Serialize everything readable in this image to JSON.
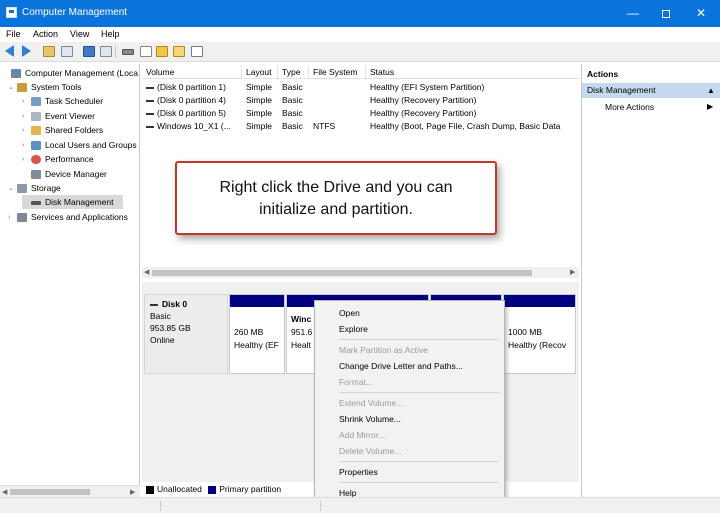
{
  "window": {
    "title": "Computer Management",
    "minimize_glyph": "—",
    "close_glyph": "✕"
  },
  "menu": [
    "File",
    "Action",
    "View",
    "Help"
  ],
  "toolbar": {
    "icons": [
      "back-icon",
      "forward-icon",
      "folder-icon",
      "view-icon",
      "properties-icon",
      "details-icon",
      "connect-icon",
      "document-icon",
      "folder-open-icon",
      "list-icon",
      "console-icon"
    ]
  },
  "tree": {
    "items": [
      {
        "label": "Computer Management (Loca",
        "level": 0,
        "expand": "",
        "icon": "computer-icon",
        "color": "#6b87a8"
      },
      {
        "label": "System Tools",
        "level": 1,
        "expand": "⌄",
        "icon": "tools-icon",
        "color": "#c99a3b"
      },
      {
        "label": "Task Scheduler",
        "level": 2,
        "expand": "›",
        "icon": "clock-icon",
        "color": "#7a9cc4"
      },
      {
        "label": "Event Viewer",
        "level": 2,
        "expand": "›",
        "icon": "event-icon",
        "color": "#a9b8c8"
      },
      {
        "label": "Shared Folders",
        "level": 2,
        "expand": "›",
        "icon": "folder-icon",
        "color": "#e0b64e"
      },
      {
        "label": "Local Users and Groups",
        "level": 2,
        "expand": "›",
        "icon": "users-icon",
        "color": "#5d8fcb"
      },
      {
        "label": "Performance",
        "level": 2,
        "expand": "›",
        "icon": "performance-icon",
        "color": "#d9534f"
      },
      {
        "label": "Device Manager",
        "level": 2,
        "expand": "",
        "icon": "device-icon",
        "color": "#7f8c99"
      },
      {
        "label": "Storage",
        "level": 1,
        "expand": "⌄",
        "icon": "storage-icon",
        "color": "#8a98a8"
      },
      {
        "label": "Disk Management",
        "level": 2,
        "expand": "",
        "icon": "disk-icon",
        "color": "#555555",
        "selected": true
      },
      {
        "label": "Services and Applications",
        "level": 1,
        "expand": "›",
        "icon": "services-icon",
        "color": "#7a8898"
      }
    ]
  },
  "table": {
    "columns": [
      "Volume",
      "Layout",
      "Type",
      "File System",
      "Status"
    ],
    "rows": [
      [
        "(Disk 0 partition 1)",
        "Simple",
        "Basic",
        "",
        "Healthy (EFI System Partition)"
      ],
      [
        "(Disk 0 partition 4)",
        "Simple",
        "Basic",
        "",
        "Healthy (Recovery Partition)"
      ],
      [
        "(Disk 0 partition 5)",
        "Simple",
        "Basic",
        "",
        "Healthy (Recovery Partition)"
      ],
      [
        "Windows 10_X1 (...",
        "Simple",
        "Basic",
        "NTFS",
        "Healthy (Boot, Page File, Crash Dump, Basic Data"
      ]
    ]
  },
  "callout": {
    "line1": "Right click the Drive and you can",
    "line2": "initialize and partition."
  },
  "disk": {
    "name": "Disk 0",
    "type": "Basic",
    "size": "953.85 GB",
    "status": "Online"
  },
  "partitions": [
    {
      "size": "260 MB",
      "status": "Healthy (EF"
    },
    {
      "name": "Winc",
      "size": "951.6",
      "status": "Healt"
    },
    {
      "size": "",
      "status": ""
    },
    {
      "size": "1000 MB",
      "status": "Healthy (Recov"
    }
  ],
  "legend": {
    "unallocated": "Unallocated",
    "primary": "Primary partition",
    "unallocated_color": "#000000",
    "primary_color": "#000080"
  },
  "context_menu": [
    {
      "label": "Open",
      "enabled": true
    },
    {
      "label": "Explore",
      "enabled": true
    },
    {
      "sep": true
    },
    {
      "label": "Mark Partition as Active",
      "enabled": false
    },
    {
      "label": "Change Drive Letter and Paths...",
      "enabled": true
    },
    {
      "label": "Format...",
      "enabled": false
    },
    {
      "sep": true
    },
    {
      "label": "Extend Volume...",
      "enabled": false
    },
    {
      "label": "Shrink Volume...",
      "enabled": true
    },
    {
      "label": "Add Mirror...",
      "enabled": false
    },
    {
      "label": "Delete Volume...",
      "enabled": false
    },
    {
      "sep": true
    },
    {
      "label": "Properties",
      "enabled": true
    },
    {
      "sep": true
    },
    {
      "label": "Help",
      "enabled": true
    }
  ],
  "actions": {
    "header": "Actions",
    "section": "Disk Management",
    "more": "More Actions",
    "section_caret": "▲",
    "more_arrow": "▶"
  },
  "colors": {
    "titlebar": "#0a74da",
    "selection": "#c5d9ee",
    "callout_border": "#c0392b"
  }
}
